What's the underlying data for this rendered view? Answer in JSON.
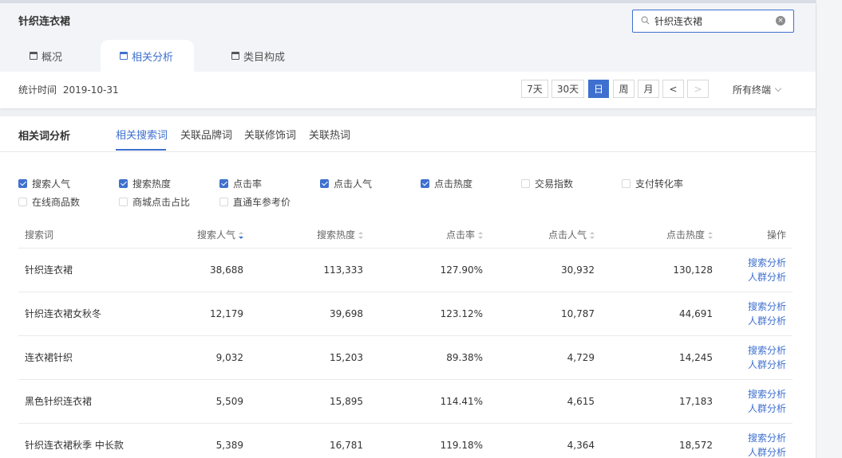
{
  "header": {
    "title": "针织连衣裙",
    "search": {
      "value": "针织连衣裙",
      "icon": "search-icon"
    }
  },
  "tabs": [
    {
      "label": "概况",
      "active": false
    },
    {
      "label": "相关分析",
      "active": true
    },
    {
      "label": "类目构成",
      "active": false
    }
  ],
  "toolbar": {
    "stat_label": "统计时间",
    "stat_date": "2019-10-31",
    "periods": [
      "7天",
      "30天",
      "日",
      "周",
      "月"
    ],
    "active_period": "日",
    "prev": "<",
    "next": ">",
    "terminal": "所有终端"
  },
  "panel": {
    "title": "相关词分析",
    "subtabs": [
      {
        "label": "相关搜索词",
        "active": true
      },
      {
        "label": "关联品牌词",
        "active": false
      },
      {
        "label": "关联修饰词",
        "active": false
      },
      {
        "label": "关联热词",
        "active": false
      }
    ]
  },
  "metrics": [
    {
      "label": "搜索人气",
      "checked": true
    },
    {
      "label": "搜索热度",
      "checked": true
    },
    {
      "label": "点击率",
      "checked": true
    },
    {
      "label": "点击人气",
      "checked": true
    },
    {
      "label": "点击热度",
      "checked": true
    },
    {
      "label": "交易指数",
      "checked": false
    },
    {
      "label": "支付转化率",
      "checked": false
    },
    {
      "label": "在线商品数",
      "checked": false
    },
    {
      "label": "商城点击占比",
      "checked": false
    },
    {
      "label": "直通车参考价",
      "checked": false
    }
  ],
  "table": {
    "columns": [
      "搜索词",
      "搜索人气",
      "搜索热度",
      "点击率",
      "点击人气",
      "点击热度",
      "操作"
    ],
    "rows": [
      {
        "keyword": "针织连衣裙",
        "search_pop": "38,688",
        "search_heat": "113,333",
        "ctr": "127.90%",
        "click_pop": "30,932",
        "click_heat": "130,128"
      },
      {
        "keyword": "针织连衣裙女秋冬",
        "search_pop": "12,179",
        "search_heat": "39,698",
        "ctr": "123.12%",
        "click_pop": "10,787",
        "click_heat": "44,691"
      },
      {
        "keyword": "连衣裙针织",
        "search_pop": "9,032",
        "search_heat": "15,203",
        "ctr": "89.38%",
        "click_pop": "4,729",
        "click_heat": "14,245"
      },
      {
        "keyword": "黑色针织连衣裙",
        "search_pop": "5,509",
        "search_heat": "15,895",
        "ctr": "114.41%",
        "click_pop": "4,615",
        "click_heat": "17,183"
      },
      {
        "keyword": "针织连衣裙秋季 中长款",
        "search_pop": "5,389",
        "search_heat": "16,781",
        "ctr": "119.18%",
        "click_pop": "4,364",
        "click_heat": "18,572"
      }
    ],
    "ops": [
      "搜索分析",
      "人群分析"
    ]
  },
  "colors": {
    "accent": "#3f70cf",
    "page_bg": "#eef0f4",
    "header_bg": "#f3f4f8"
  }
}
